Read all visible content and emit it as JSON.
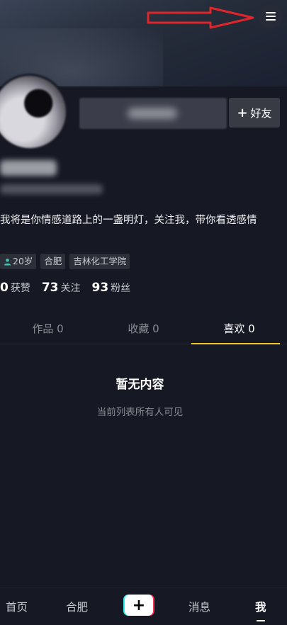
{
  "header": {
    "menu_icon": "hamburger-menu-icon",
    "annotation_color": "#e0262b"
  },
  "profile": {
    "add_friend_label": "好友",
    "bio": "我将是你情感道路上的一盏明灯，关注我，带你看透感情",
    "tags": [
      {
        "icon": "person-icon",
        "label": "20岁"
      },
      {
        "label": "合肥"
      },
      {
        "label": "吉林化工学院"
      }
    ],
    "stats": [
      {
        "num": "0",
        "label": "获赞"
      },
      {
        "num": "73",
        "label": "关注"
      },
      {
        "num": "93",
        "label": "粉丝"
      }
    ]
  },
  "tabs": [
    {
      "label": "作品 0",
      "active": false
    },
    {
      "label": "收藏 0",
      "active": false
    },
    {
      "label": "喜欢 0",
      "active": true
    }
  ],
  "empty_state": {
    "title": "暂无内容",
    "subtitle": "当前列表所有人可见"
  },
  "bottom_nav": {
    "items": [
      "首页",
      "合肥",
      "消息",
      "我"
    ],
    "plus": "+"
  },
  "colors": {
    "background": "#161823",
    "accent": "#f4c82a",
    "cyan": "#25f4ee",
    "red": "#fe2c55"
  }
}
